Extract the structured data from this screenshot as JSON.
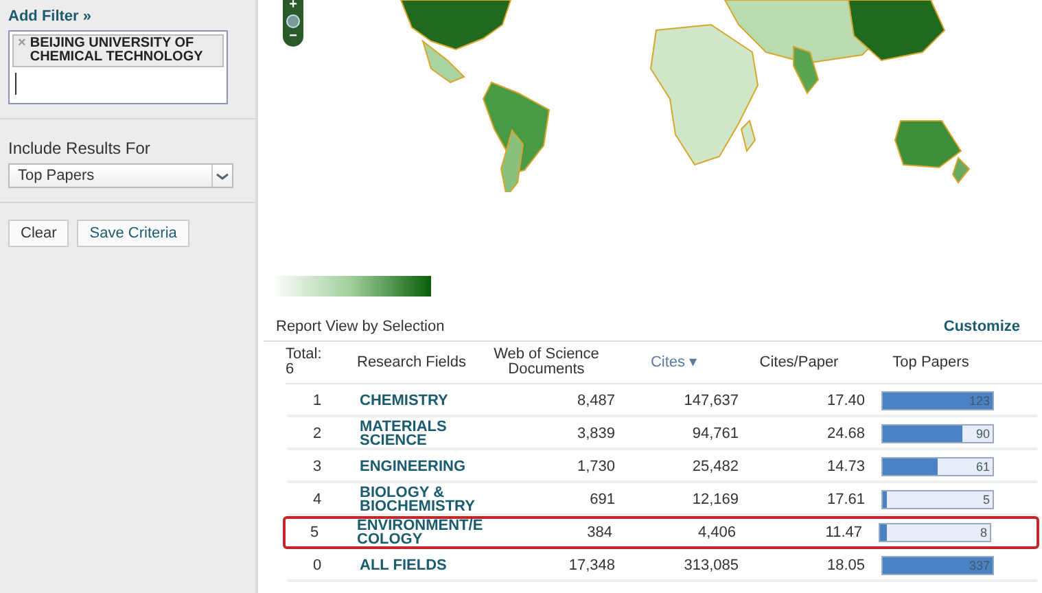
{
  "sidebar": {
    "add_filter": "Add Filter »",
    "filter_tags": [
      {
        "remove": "×",
        "label": "BEIJING UNIVERSITY OF CHEMICAL TECHNOLOGY"
      }
    ],
    "include_label": "Include Results For",
    "include_select": {
      "value": "Top Papers"
    },
    "buttons": [
      "Clear",
      "Save Criteria"
    ]
  },
  "map": {
    "zoom_in": "+",
    "zoom_out": "−"
  },
  "report": {
    "title": "Report View by Selection",
    "customize": "Customize",
    "columns": [
      {
        "label": "Total:\n6",
        "kind": "count"
      },
      {
        "label": "Research Fields",
        "kind": "text"
      },
      {
        "label": "Web of Science Documents",
        "kind": "num"
      },
      {
        "label": "Cites",
        "kind": "sorted",
        "sort_mark": "▾"
      },
      {
        "label": "Cites/Paper",
        "kind": "num"
      },
      {
        "label": "Top Papers",
        "kind": "num"
      }
    ],
    "rows": [
      {
        "rank": "1",
        "field": "CHEMISTRY",
        "docs": "8,487",
        "cites": "147,637",
        "cites_per_paper": "17.40",
        "top_papers": "123",
        "level": 1.0,
        "highlighted": false
      },
      {
        "rank": "2",
        "field": "MATERIALS SCIENCE",
        "docs": "3,839",
        "cites": "94,761",
        "cites_per_paper": "24.68",
        "top_papers": "90",
        "level": 0.73,
        "highlighted": false
      },
      {
        "rank": "3",
        "field": "ENGINEERING",
        "docs": "1,730",
        "cites": "25,482",
        "cites_per_paper": "14.73",
        "top_papers": "61",
        "level": 0.5,
        "highlighted": false
      },
      {
        "rank": "4",
        "field": "BIOLOGY & BIOCHEMISTRY",
        "docs": "691",
        "cites": "12,169",
        "cites_per_paper": "17.61",
        "top_papers": "5",
        "level": 0.04,
        "highlighted": false
      },
      {
        "rank": "5",
        "field": "ENVIRONMENT/E COLOGY",
        "docs": "384",
        "cites": "4,406",
        "cites_per_paper": "11.47",
        "top_papers": "8",
        "level": 0.065,
        "highlighted": true
      },
      {
        "rank": "0",
        "field": "ALL FIELDS",
        "docs": "17,348",
        "cites": "313,085",
        "cites_per_paper": "18.05",
        "top_papers": "337",
        "level": 1.0,
        "highlighted": false
      }
    ]
  }
}
